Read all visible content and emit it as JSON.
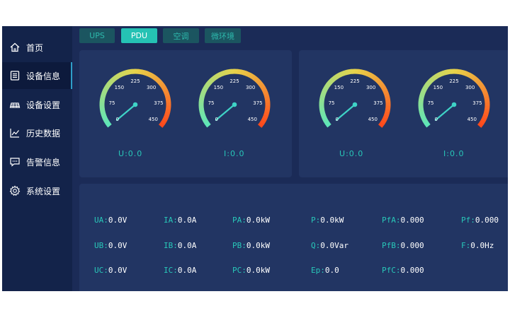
{
  "nav": [
    {
      "label": "首页",
      "icon": "home-icon"
    },
    {
      "label": "设备信息",
      "icon": "document-list-icon",
      "active": true
    },
    {
      "label": "设备设置",
      "icon": "keyboard-icon"
    },
    {
      "label": "历史数据",
      "icon": "line-chart-icon"
    },
    {
      "label": "告警信息",
      "icon": "message-icon"
    },
    {
      "label": "系统设置",
      "icon": "gear-icon"
    }
  ],
  "tabs": [
    {
      "label": "UPS"
    },
    {
      "label": "PDU",
      "active": true
    },
    {
      "label": "空调"
    },
    {
      "label": "微环境"
    }
  ],
  "gauge_ticks": [
    "0",
    "75",
    "150",
    "225",
    "300",
    "375",
    "450"
  ],
  "gauges": [
    {
      "caption_label": "U",
      "caption_value": "0.0",
      "value": 0
    },
    {
      "caption_label": "I",
      "caption_value": "0.0",
      "value": 0
    },
    {
      "caption_label": "U",
      "caption_value": "0.0",
      "value": 0
    },
    {
      "caption_label": "I",
      "caption_value": "0.0",
      "value": 0
    }
  ],
  "metrics": [
    [
      {
        "label": "UA",
        "value": "0.0V"
      },
      {
        "label": "IA",
        "value": "0.0A"
      },
      {
        "label": "PA",
        "value": "0.0kW"
      },
      {
        "label": "P",
        "value": "0.0kW"
      },
      {
        "label": "PfA",
        "value": "0.000"
      },
      {
        "label": "Pf",
        "value": "0.000"
      }
    ],
    [
      {
        "label": "UB",
        "value": "0.0V"
      },
      {
        "label": "IB",
        "value": "0.0A"
      },
      {
        "label": "PB",
        "value": "0.0kW"
      },
      {
        "label": "Q",
        "value": "0.0Var"
      },
      {
        "label": "PfB",
        "value": "0.000"
      },
      {
        "label": "F",
        "value": "0.0Hz"
      }
    ],
    [
      {
        "label": "UC",
        "value": "0.0V"
      },
      {
        "label": "IC",
        "value": "0.0A"
      },
      {
        "label": "PC",
        "value": "0.0kW"
      },
      {
        "label": "Ep",
        "value": "0.0"
      },
      {
        "label": "PfC",
        "value": "0.000"
      }
    ]
  ],
  "colors": {
    "accent": "#28c7b8",
    "gauge_start": "#5ee6b8",
    "gauge_mid": "#e8d34a",
    "gauge_end": "#ff4a1c",
    "needle": "#3fd3c6"
  }
}
